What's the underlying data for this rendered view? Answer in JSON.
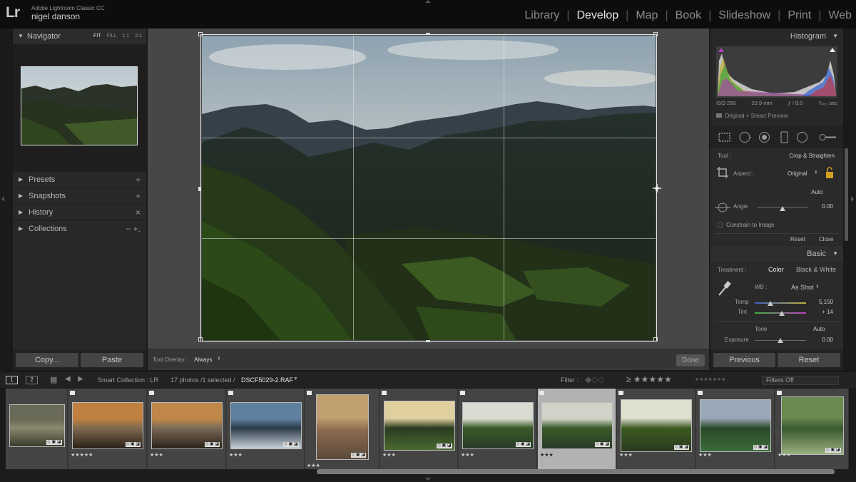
{
  "app": {
    "logo": "Lr",
    "name": "Adobe Lightroom Classic CC",
    "user": "nigel danson"
  },
  "modules": [
    "Library",
    "Develop",
    "Map",
    "Book",
    "Slideshow",
    "Print",
    "Web"
  ],
  "active_module": "Develop",
  "left_panel": {
    "navigator": {
      "title": "Navigator",
      "zoom_options": [
        "FIT",
        "FILL",
        "1:1",
        "2:1"
      ],
      "active_zoom": "FIT"
    },
    "sections": [
      {
        "label": "Presets",
        "action": "+"
      },
      {
        "label": "Snapshots",
        "action": "+"
      },
      {
        "label": "History",
        "action": "×"
      },
      {
        "label": "Collections",
        "action": "− +."
      }
    ],
    "copy_label": "Copy...",
    "paste_label": "Paste"
  },
  "toolbar": {
    "overlay_label": "Tool Overlay :",
    "overlay_value": "Always",
    "done_label": "Done"
  },
  "right_panel": {
    "histogram_title": "Histogram",
    "exif": {
      "iso": "ISO 250",
      "focal": "20.9 mm",
      "aperture": "ƒ / 8.0",
      "shutter": "¹⁄₄₀₀ sec"
    },
    "preview_status": "Original + Smart Preview",
    "crop": {
      "tool_label": "Tool :",
      "tool_value": "Crop & Straighten",
      "aspect_label": "Aspect :",
      "aspect_value": "Original",
      "auto_label": "Auto",
      "angle_label": "Angle",
      "angle_value": "0.00",
      "angle_level": 0.5,
      "constrain_label": "Constrain to Image",
      "reset_label": "Reset",
      "close_label": "Close"
    },
    "basic": {
      "title": "Basic",
      "treatment_label": "Treatment :",
      "treatment_options": [
        "Color",
        "Black & White"
      ],
      "active_treatment": "Color",
      "wb_label": "WB :",
      "wb_value": "As Shot",
      "temp_label": "Temp",
      "temp_value": "5,150",
      "temp_level": 0.3,
      "tint_label": "Tint",
      "tint_value": "+ 14",
      "tint_level": 0.53,
      "tone_label": "Tone",
      "tone_auto": "Auto",
      "exposure_label": "Exposure",
      "exposure_value": "0.00",
      "exposure_level": 0.5
    },
    "previous_label": "Previous",
    "reset_label": "Reset"
  },
  "filmstrip_bar": {
    "monitor1": "1",
    "monitor2": "2",
    "collection": "Smart Collection : LR",
    "photo_count": "17 photos /1 selected /",
    "filename": "DSCF5029-2.RAF",
    "filter_label": "Filter :",
    "filters_off": "Filters Off"
  },
  "filmstrip": [
    {
      "rating": "",
      "selected": false
    },
    {
      "rating": "★★★★★",
      "selected": false
    },
    {
      "rating": "★★★",
      "selected": false
    },
    {
      "rating": "★★★",
      "selected": false
    },
    {
      "rating": "★★★",
      "selected": false
    },
    {
      "rating": "★★★",
      "selected": false
    },
    {
      "rating": "★★★",
      "selected": false
    },
    {
      "rating": "★★★",
      "selected": true
    },
    {
      "rating": "★★★",
      "selected": false
    },
    {
      "rating": "★★★",
      "selected": false
    },
    {
      "rating": "★★★",
      "selected": false
    }
  ]
}
